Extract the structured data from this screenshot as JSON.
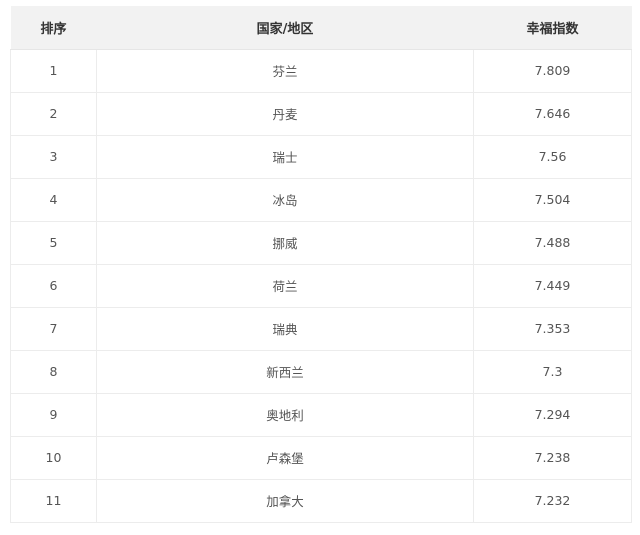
{
  "table": {
    "headers": {
      "rank": "排序",
      "country": "国家/地区",
      "score": "幸福指数"
    },
    "rows": [
      {
        "rank": "1",
        "country": "芬兰",
        "score": "7.809"
      },
      {
        "rank": "2",
        "country": "丹麦",
        "score": "7.646"
      },
      {
        "rank": "3",
        "country": "瑞士",
        "score": "7.56"
      },
      {
        "rank": "4",
        "country": "冰岛",
        "score": "7.504"
      },
      {
        "rank": "5",
        "country": "挪威",
        "score": "7.488"
      },
      {
        "rank": "6",
        "country": "荷兰",
        "score": "7.449"
      },
      {
        "rank": "7",
        "country": "瑞典",
        "score": "7.353"
      },
      {
        "rank": "8",
        "country": "新西兰",
        "score": "7.3"
      },
      {
        "rank": "9",
        "country": "奥地利",
        "score": "7.294"
      },
      {
        "rank": "10",
        "country": "卢森堡",
        "score": "7.238"
      },
      {
        "rank": "11",
        "country": "加拿大",
        "score": "7.232"
      }
    ]
  }
}
